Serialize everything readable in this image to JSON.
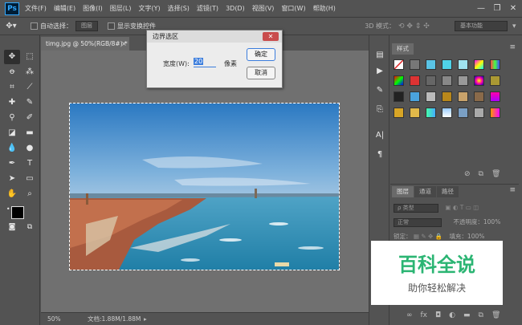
{
  "app": {
    "logo": "Ps"
  },
  "menu": [
    "文件(F)",
    "编辑(E)",
    "图像(I)",
    "图层(L)",
    "文字(Y)",
    "选择(S)",
    "滤镜(T)",
    "3D(D)",
    "视图(V)",
    "窗口(W)",
    "帮助(H)"
  ],
  "window_controls": {
    "minimize": "—",
    "restore": "❐",
    "close": "✕"
  },
  "options_bar": {
    "auto_select_label": "自动选择：",
    "auto_select_value": "图层",
    "show_transform_label": "显示变换控件",
    "mode_label": "3D 模式：",
    "workspace": "基本功能"
  },
  "document": {
    "tab_label": "timg.jpg @ 50%(RGB/8#) *",
    "zoom": "50%",
    "doc_size": "文档:1.88M/1.88M"
  },
  "dialog": {
    "title": "边界选区",
    "width_label": "宽度(W):",
    "width_value": "20",
    "unit": "像素",
    "ok": "确定",
    "cancel": "取消",
    "close": "✕"
  },
  "styles_panel": {
    "tab": "样式"
  },
  "layers_panel": {
    "tabs": [
      "图层",
      "通道",
      "路径"
    ],
    "filter_label": "ρ 类型",
    "blend_mode": "正常",
    "opacity_label": "不透明度：100%",
    "lock_label": "锁定：",
    "fill_label": "填充：100%"
  },
  "watermark": {
    "title": "百科全说",
    "subtitle": "助你轻松解决"
  },
  "colors": {
    "ui_dark": "#535353",
    "canvas_bg": "#707070",
    "accent_blue": "#3b7ddd",
    "watermark_green": "#2bb573"
  },
  "icons": {
    "tools": [
      "move-icon",
      "marquee-icon",
      "lasso-icon",
      "magic-wand-icon",
      "crop-icon",
      "eyedropper-icon",
      "healing-icon",
      "brush-icon",
      "stamp-icon",
      "history-brush-icon",
      "eraser-icon",
      "gradient-icon",
      "blur-icon",
      "dodge-icon",
      "pen-icon",
      "type-icon",
      "path-select-icon",
      "shape-icon",
      "hand-icon",
      "zoom-icon"
    ]
  }
}
